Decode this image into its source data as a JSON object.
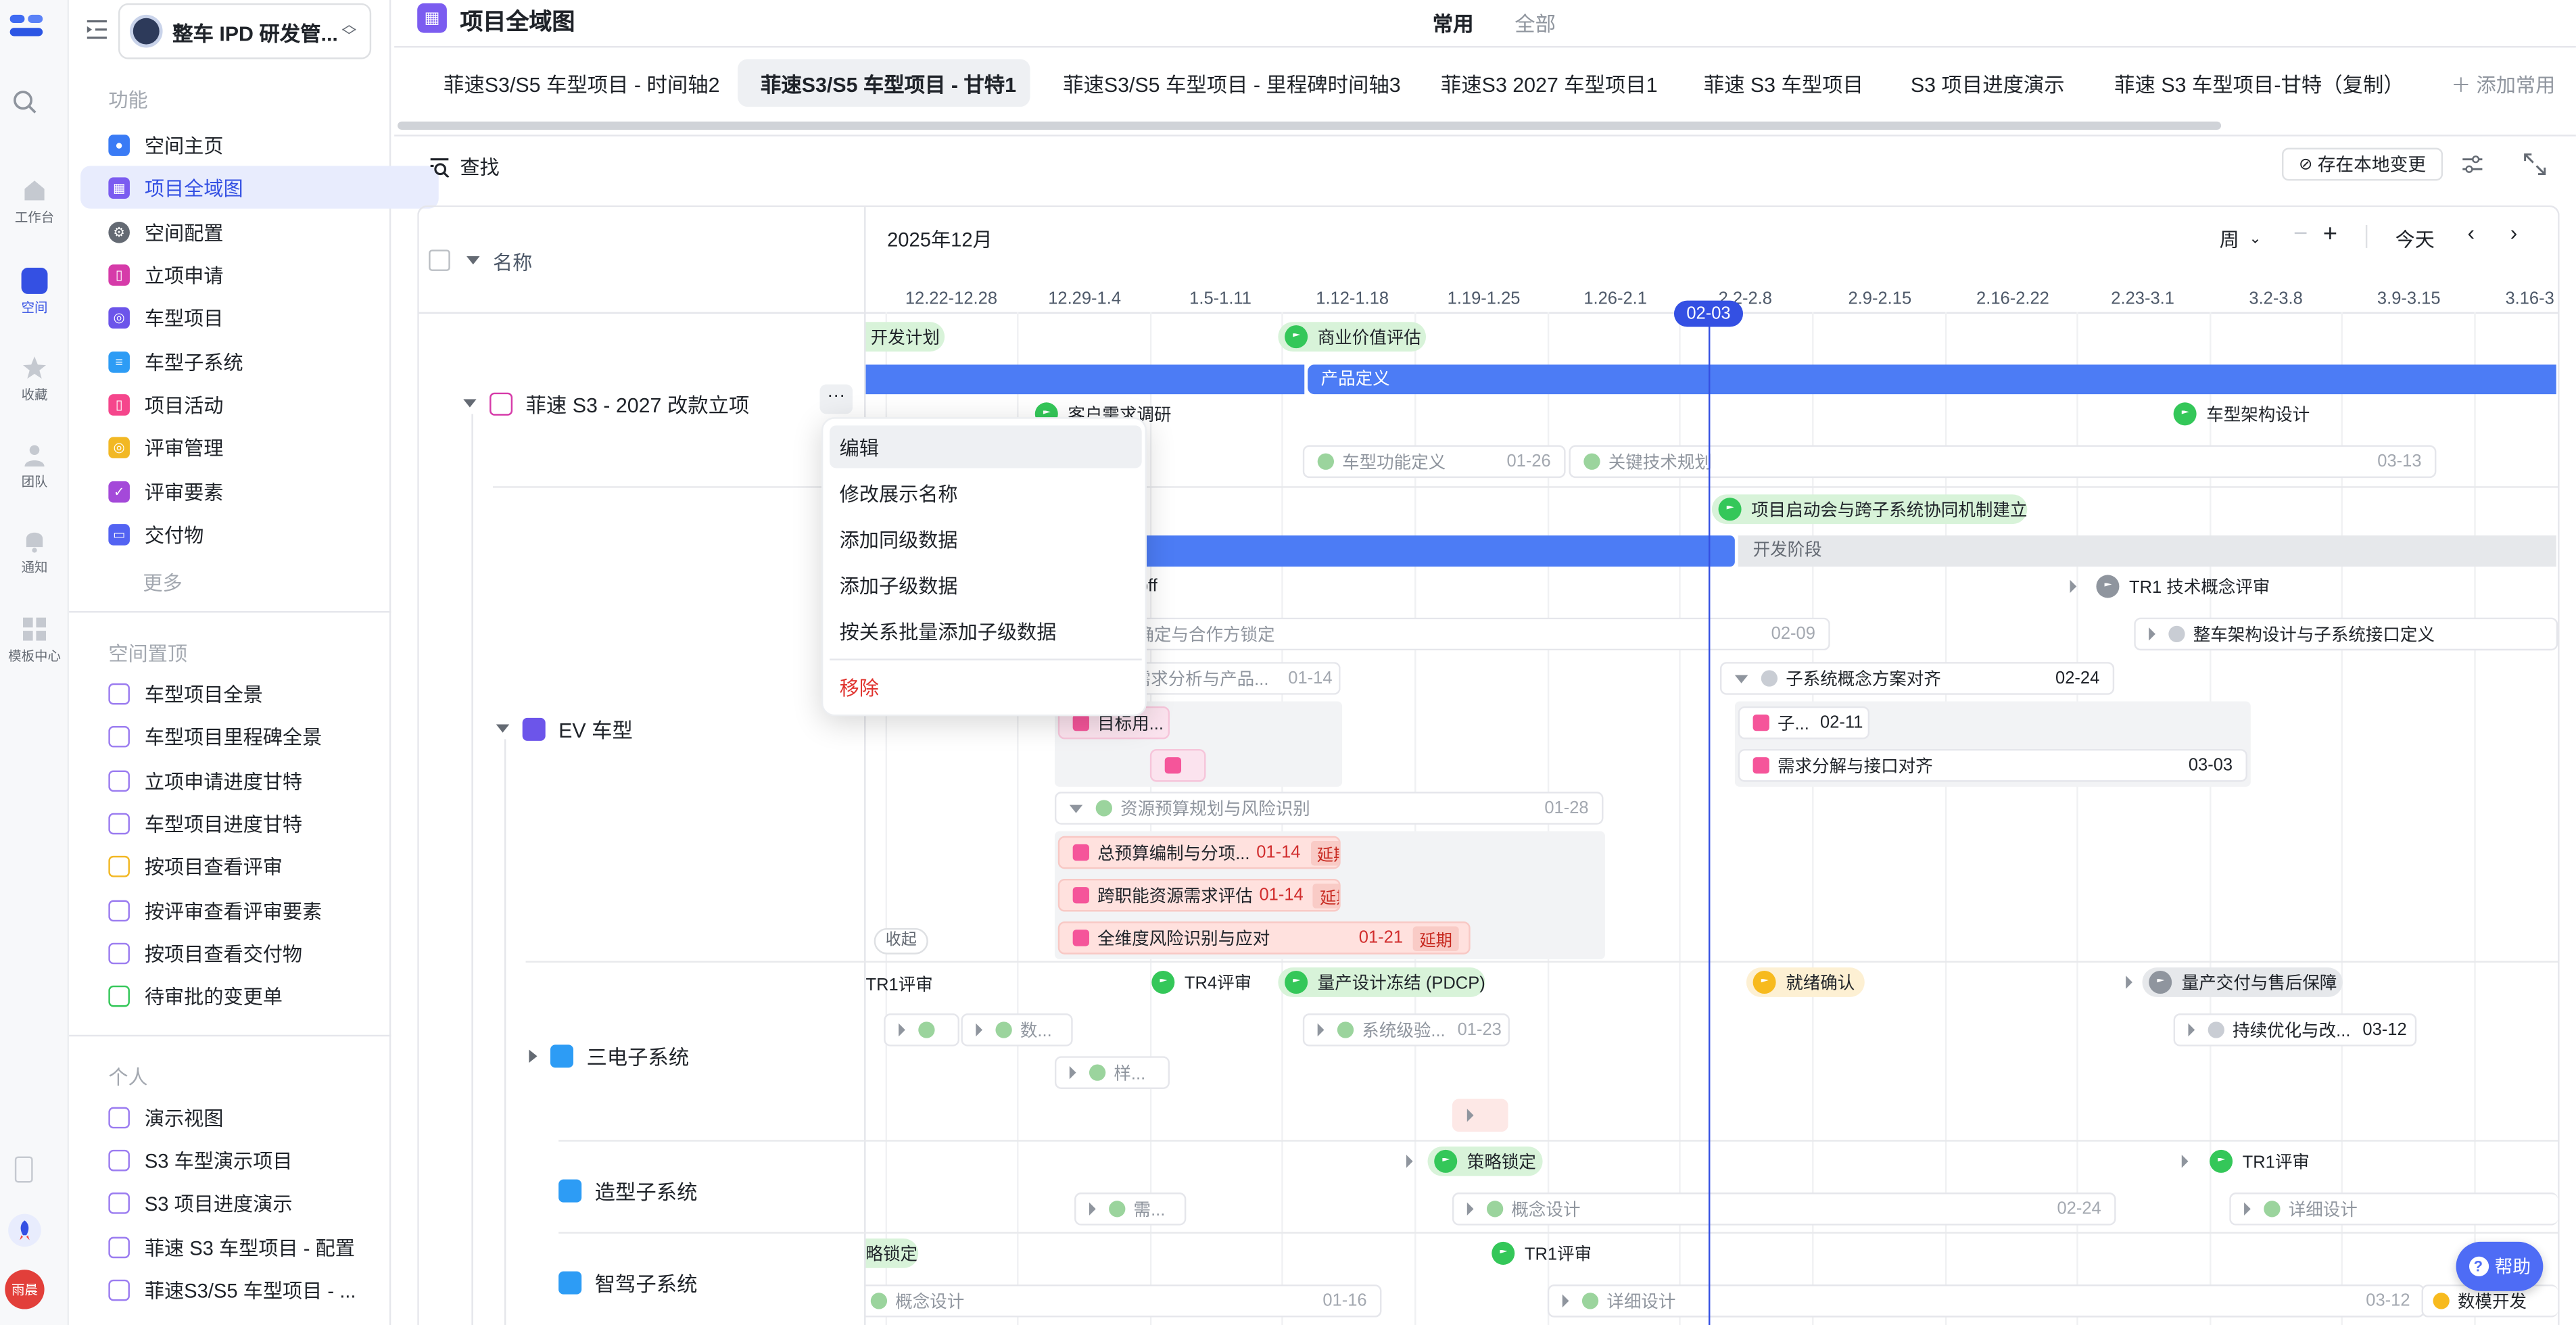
{
  "rail": {
    "items": [
      {
        "label": "工作台",
        "icon": "home-icon"
      },
      {
        "label": "空间",
        "icon": "space-icon"
      },
      {
        "label": "收藏",
        "icon": "star-icon"
      },
      {
        "label": "团队",
        "icon": "team-icon"
      },
      {
        "label": "通知",
        "icon": "bell-icon"
      },
      {
        "label": "模板中心",
        "icon": "template-icon"
      }
    ],
    "avatar": "雨晨"
  },
  "sidebar": {
    "workspace": "整车 IPD 研发管...",
    "section_func": "功能",
    "func_items": [
      "空间主页",
      "项目全域图",
      "空间配置",
      "立项申请",
      "车型项目",
      "车型子系统",
      "项目活动",
      "评审管理",
      "评审要素",
      "交付物"
    ],
    "more": "更多",
    "section_pinned": "空间置顶",
    "pinned_items": [
      "车型项目全景",
      "车型项目里程碑全景",
      "立项申请进度甘特",
      "车型项目进度甘特",
      "按项目查看评审",
      "按评审查看评审要素",
      "按项目查看交付物",
      "待审批的变更单"
    ],
    "section_personal": "个人",
    "personal_items": [
      "演示视图",
      "S3 车型演示项目",
      "S3 项目进度演示",
      "菲速 S3 车型项目 - 配置",
      "菲速S3/S5 车型项目 - ..."
    ]
  },
  "header": {
    "title": "项目全域图",
    "mode_common": "常用",
    "mode_all": "全部",
    "add_common": "添加常用"
  },
  "tabs": [
    "菲速S3/S5 车型项目 - 时间轴2",
    "菲速S3/S5 车型项目 - 甘特1",
    "菲速S3/S5 车型项目 - 里程碑时间轴3",
    "菲速S3 2027 车型项目1",
    "菲速 S3 车型项目",
    "S3 项目进度演示",
    "菲速 S3 车型项目-甘特（复制）"
  ],
  "toolbar": {
    "search": "查找",
    "save_local": "存在本地变更"
  },
  "gantt": {
    "name_col": "名称",
    "month": "2025年12月",
    "scale": "周",
    "today": "今天",
    "today_marker": "02-03",
    "weeks": [
      "12.22-12.28",
      "12.29-1.4",
      "1.5-1.11",
      "1.12-1.18",
      "1.19-1.25",
      "1.26-2.1",
      "2.2-2.8",
      "2.9-2.15",
      "2.16-2.22",
      "2.23-3.1",
      "3.2-3.8",
      "3.9-3.15",
      "3.16-3"
    ],
    "rows": {
      "r1": "菲速 S3 - 2027 改款立项",
      "r2": "EV 车型",
      "r3": "三电子系统",
      "r4": "造型子系统",
      "r5": "智驾子系统"
    },
    "collapse": "收起",
    "help": "帮助"
  },
  "bars": {
    "dev_plan": "开发计划",
    "biz_eval": "商业价值评估",
    "product_def": "产品定义",
    "customer_research": "客户需求调研",
    "arch_design": "车型架构设计",
    "func_def": "车型功能定义",
    "func_def_date": "01-26",
    "key_tech": "关键技术规划",
    "key_tech_date": "03-13",
    "kickoff_meeting": "项目启动会与跨子系统协同机制建立",
    "dev_stage": "开发阶段",
    "kickoff_tail": "off",
    "tr1_concept": "TR1 技术概念评审",
    "confirm_partner": "确定与合作方锁定",
    "confirm_partner_date": "02-09",
    "arch_interface": "整车架构设计与子系统接口定义",
    "needs_analysis": "需求分析与产品...",
    "needs_analysis_date": "01-14",
    "subsys_concept": "子系统概念方案对齐",
    "subsys_concept_date": "02-24",
    "target_user": "目标用...",
    "sub_short": "子...",
    "sub_short_date": "02-11",
    "req_decomp": "需求分解与接口对齐",
    "req_decomp_date": "03-03",
    "resource_plan": "资源预算规划与风险识别",
    "resource_plan_date": "01-28",
    "budget": "总预算编制与分项...",
    "budget_date": "01-14",
    "cross_func": "跨职能资源需求评估",
    "cross_func_date": "01-14",
    "risk_all": "全维度风险识别与应对",
    "risk_all_date": "01-21",
    "delay": "延期",
    "tr1_review": "TR1评审",
    "tr4_review": "TR4评审",
    "pdcp": "量产设计冻结 (PDCP)",
    "ready_confirm": "就绪确认",
    "mass_delivery": "量产交付与售后保障",
    "data_short": "数...",
    "sys_verify": "系统级验...",
    "sys_verify_date": "01-23",
    "continuous_opt": "持续优化与改...",
    "continuous_opt_date": "03-12",
    "sample_short": "样...",
    "strategy_lock": "策略锁定",
    "tr1_review_2": "TR1评审",
    "need_short": "需...",
    "concept_design": "概念设计",
    "concept_design_date": "02-24",
    "detail_design": "详细设计",
    "strategy_lock_short": "略锁定",
    "tr1_review_3": "TR1评审",
    "concept_design_2": "概念设计",
    "concept_design_2_date": "01-16",
    "detail_design_2": "详细设计",
    "detail_design_2_date": "03-12",
    "mass_dev": "数模开发"
  },
  "menu": {
    "edit": "编辑",
    "rename": "修改展示名称",
    "add_sibling": "添加同级数据",
    "add_child": "添加子级数据",
    "bulk_add": "按关系批量添加子级数据",
    "remove": "移除"
  },
  "colors": {
    "accent": "#3450e3",
    "bar_blue": "#4c7cf5",
    "milestone_green": "#34c759",
    "delay_red": "#d12d2d"
  }
}
